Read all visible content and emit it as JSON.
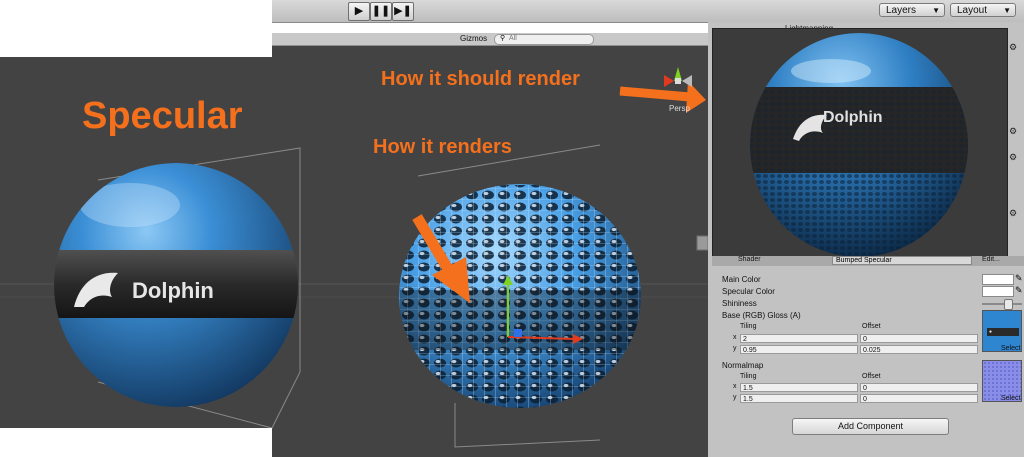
{
  "toolbar": {
    "play_icon": "play-icon",
    "pause_icon": "pause-icon",
    "step_icon": "step-icon",
    "layers_label": "Layers",
    "layout_label": "Layout"
  },
  "scene_header": {
    "gizmos_label": "Gizmos",
    "search_placeholder": "All",
    "persp_label": "Persp"
  },
  "inspector_tabs": {
    "lightmapping_label": "Lightmapping"
  },
  "annotations": {
    "title": "Specular",
    "how_it_renders": "How it renders",
    "how_it_should_render": "How it should render"
  },
  "sphere_text": "Dolphin",
  "shader": {
    "label": "Shader",
    "value": "Bumped Specular",
    "edit_label": "Edit..."
  },
  "material": {
    "main_color_label": "Main Color",
    "specular_color_label": "Specular Color",
    "shininess_label": "Shininess",
    "base_label": "Base (RGB) Gloss (A)",
    "base_tiling_header": "Tiling",
    "base_offset_header": "Offset",
    "base_x_label": "x",
    "base_y_label": "y",
    "base_tiling_x": "2",
    "base_tiling_y": "0.95",
    "base_offset_x": "0",
    "base_offset_y": "0.025",
    "base_select_label": "Select",
    "normal_label": "Normalmap",
    "normal_tiling_header": "Tiling",
    "normal_offset_header": "Offset",
    "normal_x_label": "x",
    "normal_y_label": "y",
    "normal_tiling_x": "1.5",
    "normal_tiling_y": "1.5",
    "normal_offset_x": "0",
    "normal_offset_y": "0",
    "normal_select_label": "Select"
  },
  "add_component_label": "Add Component",
  "colors": {
    "annotation_orange": "#f4701c",
    "sphere_blue": "#2f86d0",
    "band_dark": "#2a2a2a",
    "scene_bg": "#434343",
    "inspector_bg": "#c2c2c2"
  }
}
